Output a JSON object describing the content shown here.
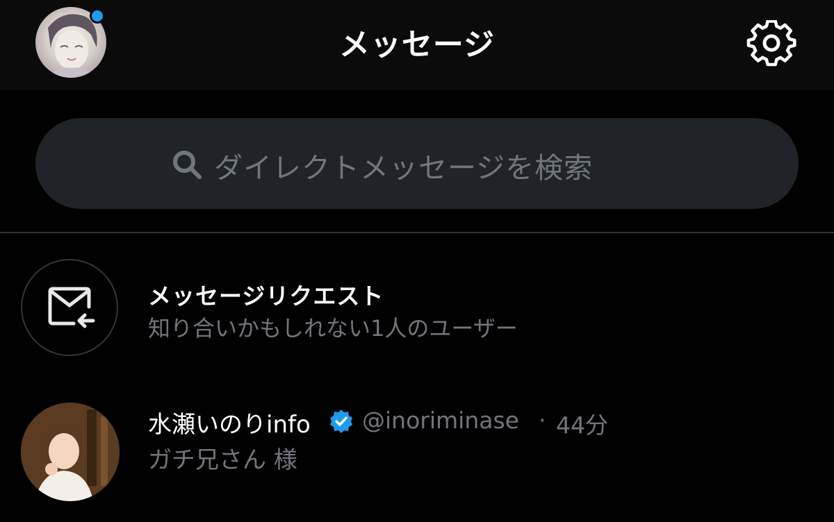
{
  "header": {
    "title": "メッセージ",
    "profile_avatar_icon": "profile-avatar",
    "notification_dot_color": "#1d9bf0",
    "settings_icon": "gear-icon"
  },
  "search": {
    "placeholder": "ダイレクトメッセージを検索",
    "icon": "search-icon"
  },
  "message_requests": {
    "icon": "mail-incoming-icon",
    "title": "メッセージリクエスト",
    "subtitle": "知り合いかもしれない1人のユーザー"
  },
  "conversations": [
    {
      "name": "水瀬いのりinfo",
      "verified": true,
      "verified_color": "#1d9bf0",
      "handle": "@inoriminase",
      "separator": "·",
      "time": "44分",
      "preview": "ガチ兄さん 様"
    }
  ],
  "colors": {
    "background": "#000000",
    "header_background": "#0b0b0b",
    "search_background": "#202327",
    "secondary_text": "#71767b",
    "primary_text": "#ffffff",
    "accent": "#1d9bf0",
    "divider": "#333639"
  }
}
